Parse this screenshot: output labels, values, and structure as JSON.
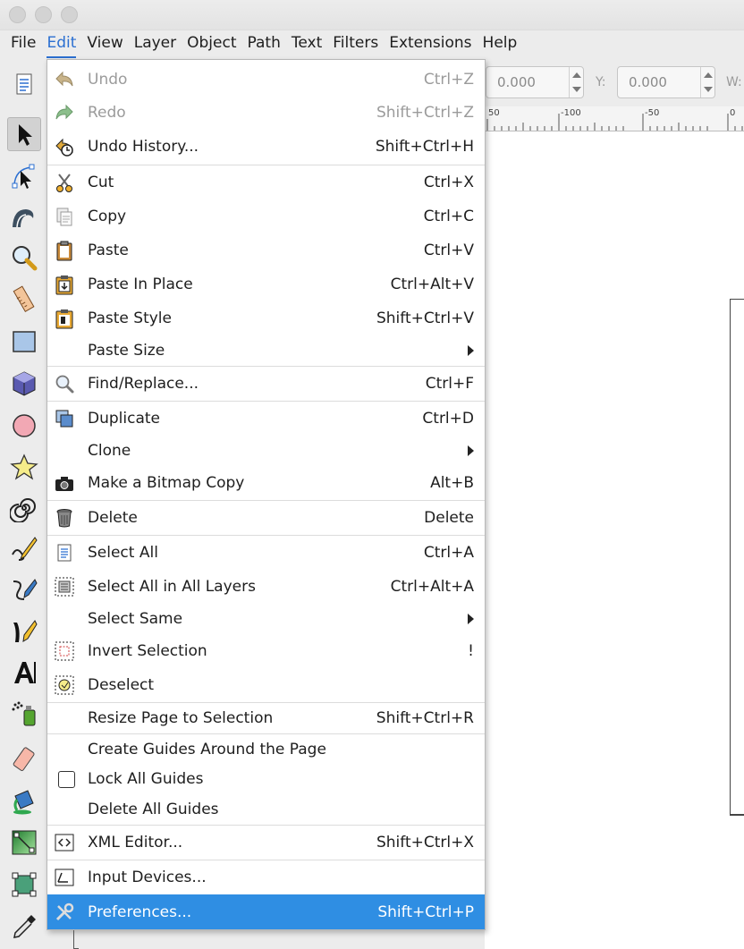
{
  "menubar": {
    "items": [
      "File",
      "Edit",
      "View",
      "Layer",
      "Object",
      "Path",
      "Text",
      "Filters",
      "Extensions",
      "Help"
    ],
    "active": "Edit"
  },
  "controls": {
    "x_value": "0.000",
    "y_label": "Y:",
    "y_value": "0.000",
    "w_label": "W:"
  },
  "ruler": {
    "labels": [
      "50",
      "-100",
      "-50",
      "0"
    ]
  },
  "edit_menu": {
    "undo": {
      "label": "Undo",
      "shortcut": "Ctrl+Z"
    },
    "redo": {
      "label": "Redo",
      "shortcut": "Shift+Ctrl+Z"
    },
    "undo_history": {
      "label": "Undo History...",
      "shortcut": "Shift+Ctrl+H"
    },
    "cut": {
      "label": "Cut",
      "shortcut": "Ctrl+X"
    },
    "copy": {
      "label": "Copy",
      "shortcut": "Ctrl+C"
    },
    "paste": {
      "label": "Paste",
      "shortcut": "Ctrl+V"
    },
    "paste_in_place": {
      "label": "Paste In Place",
      "shortcut": "Ctrl+Alt+V"
    },
    "paste_style": {
      "label": "Paste Style",
      "shortcut": "Shift+Ctrl+V"
    },
    "paste_size": {
      "label": "Paste Size"
    },
    "find_replace": {
      "label": "Find/Replace...",
      "shortcut": "Ctrl+F"
    },
    "duplicate": {
      "label": "Duplicate",
      "shortcut": "Ctrl+D"
    },
    "clone": {
      "label": "Clone"
    },
    "bitmap_copy": {
      "label": "Make a Bitmap Copy",
      "shortcut": "Alt+B"
    },
    "delete": {
      "label": "Delete",
      "shortcut": "Delete"
    },
    "select_all": {
      "label": "Select All",
      "shortcut": "Ctrl+A"
    },
    "select_all_layers": {
      "label": "Select All in All Layers",
      "shortcut": "Ctrl+Alt+A"
    },
    "select_same": {
      "label": "Select Same"
    },
    "invert_selection": {
      "label": "Invert Selection",
      "shortcut": "!"
    },
    "deselect": {
      "label": "Deselect"
    },
    "resize_page": {
      "label": "Resize Page to Selection",
      "shortcut": "Shift+Ctrl+R"
    },
    "create_guides": {
      "label": "Create Guides Around the Page"
    },
    "lock_guides": {
      "label": "Lock All Guides"
    },
    "delete_guides": {
      "label": "Delete All Guides"
    },
    "xml_editor": {
      "label": "XML Editor...",
      "shortcut": "Shift+Ctrl+X"
    },
    "input_devices": {
      "label": "Input Devices..."
    },
    "preferences": {
      "label": "Preferences...",
      "shortcut": "Shift+Ctrl+P"
    }
  },
  "colors": {
    "highlight": "#2f8ee3",
    "active_menu": "#2b6fd1"
  }
}
